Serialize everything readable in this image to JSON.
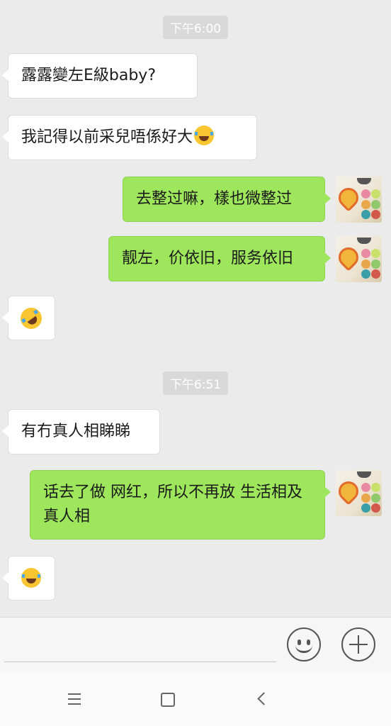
{
  "colors": {
    "background": "#ebebeb",
    "sent_bubble": "#9ee65c",
    "received_bubble": "#ffffff"
  },
  "chat": {
    "timestamps": [
      "下午6:00",
      "下午6:51"
    ],
    "messages": [
      {
        "side": "left",
        "text": "露露變左E級baby?"
      },
      {
        "side": "left",
        "text": "我記得以前采兒唔係好大",
        "emoji": "face-with-tears-of-joy"
      },
      {
        "side": "right",
        "text": "去整过嘛，樣也微整过"
      },
      {
        "side": "right",
        "text": "靓左，价依旧，服务依旧"
      },
      {
        "side": "left",
        "emoji": "rolling-on-floor-laughing"
      },
      {
        "side": "left",
        "text": "有冇真人相睇睇"
      },
      {
        "side": "right",
        "text": "话去了做 网红，所以不再放 生活相及真人相"
      },
      {
        "side": "left",
        "emoji": "face-with-tears-of-joy"
      }
    ]
  },
  "input_bar": {
    "icons": [
      "emoji-icon",
      "plus-icon"
    ]
  },
  "navbar": {
    "icons": [
      "menu-icon",
      "home-icon",
      "back-icon"
    ]
  }
}
